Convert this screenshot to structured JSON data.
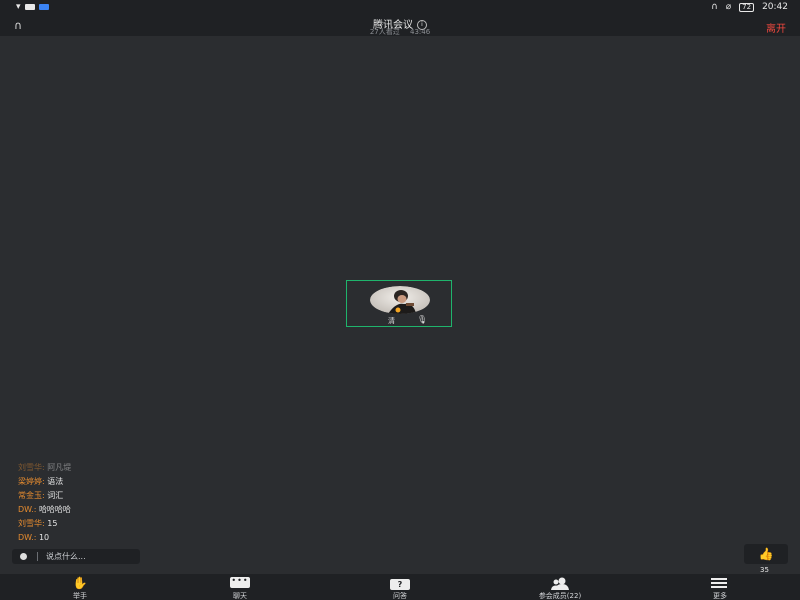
{
  "status_bar": {
    "time": "20:42",
    "battery": "72"
  },
  "header": {
    "title": "腾讯会议",
    "viewers": "27人看过",
    "duration": "43:46",
    "leave_label": "离开"
  },
  "participant": {
    "name": "清"
  },
  "chat": {
    "messages": [
      {
        "who": "刘雪华:",
        "text": "阿凡堤"
      },
      {
        "who": "梁婷婷:",
        "text": "语法"
      },
      {
        "who": "常金玉:",
        "text": "词汇"
      },
      {
        "who": "DW.:",
        "text": "哈哈哈哈"
      },
      {
        "who": "刘雪华:",
        "text": "15"
      },
      {
        "who": "DW.:",
        "text": "10"
      }
    ],
    "input_placeholder": "说点什么..."
  },
  "like": {
    "count": "35"
  },
  "toolbar": {
    "items": [
      {
        "label": "举手",
        "icon": "raise-hand-icon"
      },
      {
        "label": "聊天",
        "icon": "chat-icon"
      },
      {
        "label": "问答",
        "icon": "qa-icon"
      },
      {
        "label": "参会成员(22)",
        "icon": "members-icon"
      },
      {
        "label": "更多",
        "icon": "more-icon"
      }
    ]
  },
  "colors": {
    "background": "#2b2d30",
    "bar": "#1f2124",
    "leave": "#f0483e",
    "speaker_border": "#1fb46c",
    "chat_name": "#e58b2f"
  }
}
